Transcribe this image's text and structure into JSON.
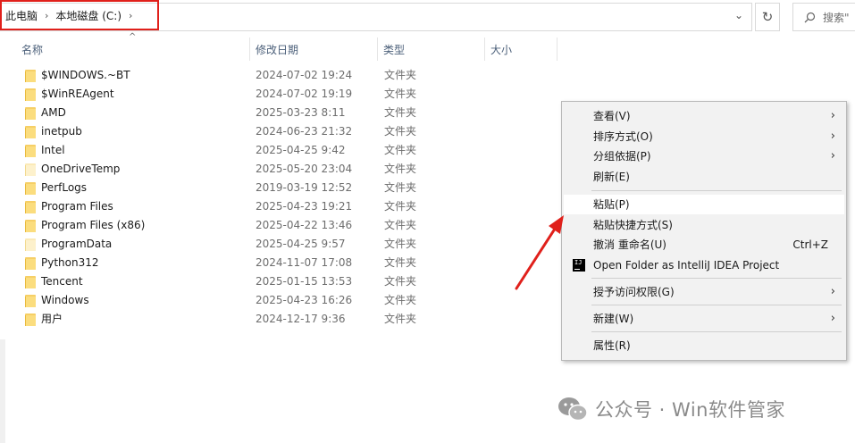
{
  "address": {
    "crumbs": [
      "此电脑",
      "本地磁盘 (C:)"
    ],
    "trailing_chevron": "›",
    "dropdown": "⌄",
    "refresh": "↻",
    "search_placeholder": "搜索\""
  },
  "columns": {
    "name": "名称",
    "modified": "修改日期",
    "type": "类型",
    "size": "大小",
    "sort_caret": "^"
  },
  "rows": [
    {
      "name": "$WINDOWS.~BT",
      "date": "2024-07-02 19:24",
      "type": "文件夹",
      "faded": false
    },
    {
      "name": "$WinREAgent",
      "date": "2024-07-02 19:19",
      "type": "文件夹",
      "faded": false
    },
    {
      "name": "AMD",
      "date": "2025-03-23 8:11",
      "type": "文件夹",
      "faded": false
    },
    {
      "name": "inetpub",
      "date": "2024-06-23 21:32",
      "type": "文件夹",
      "faded": false
    },
    {
      "name": "Intel",
      "date": "2025-04-25 9:42",
      "type": "文件夹",
      "faded": false
    },
    {
      "name": "OneDriveTemp",
      "date": "2025-05-20 23:04",
      "type": "文件夹",
      "faded": true
    },
    {
      "name": "PerfLogs",
      "date": "2019-03-19 12:52",
      "type": "文件夹",
      "faded": false
    },
    {
      "name": "Program Files",
      "date": "2025-04-23 19:21",
      "type": "文件夹",
      "faded": false
    },
    {
      "name": "Program Files (x86)",
      "date": "2025-04-22 13:46",
      "type": "文件夹",
      "faded": false
    },
    {
      "name": "ProgramData",
      "date": "2025-04-25 9:57",
      "type": "文件夹",
      "faded": true
    },
    {
      "name": "Python312",
      "date": "2024-11-07 17:08",
      "type": "文件夹",
      "faded": false
    },
    {
      "name": "Tencent",
      "date": "2025-01-15 13:53",
      "type": "文件夹",
      "faded": false
    },
    {
      "name": "Windows",
      "date": "2025-04-23 16:26",
      "type": "文件夹",
      "faded": false
    },
    {
      "name": "用户",
      "date": "2024-12-17 9:36",
      "type": "文件夹",
      "faded": false
    }
  ],
  "menu": {
    "view": "查看(V)",
    "sort": "排序方式(O)",
    "group": "分组依据(P)",
    "refresh": "刷新(E)",
    "paste": "粘贴(P)",
    "paste_shortcut": "粘贴快捷方式(S)",
    "undo": "撤消 重命名(U)",
    "undo_keys": "Ctrl+Z",
    "intellij": "Open Folder as IntelliJ IDEA Project",
    "intellij_icon_text": "IJ",
    "grant_access": "授予访问权限(G)",
    "new": "新建(W)",
    "properties": "属性(R)",
    "submenu_arrow": "›"
  },
  "watermark": "公众号 · Win软件管家",
  "colors": {
    "highlight_box": "#e0201b",
    "arrow": "#e0201b",
    "folder": "#f6cf66"
  }
}
